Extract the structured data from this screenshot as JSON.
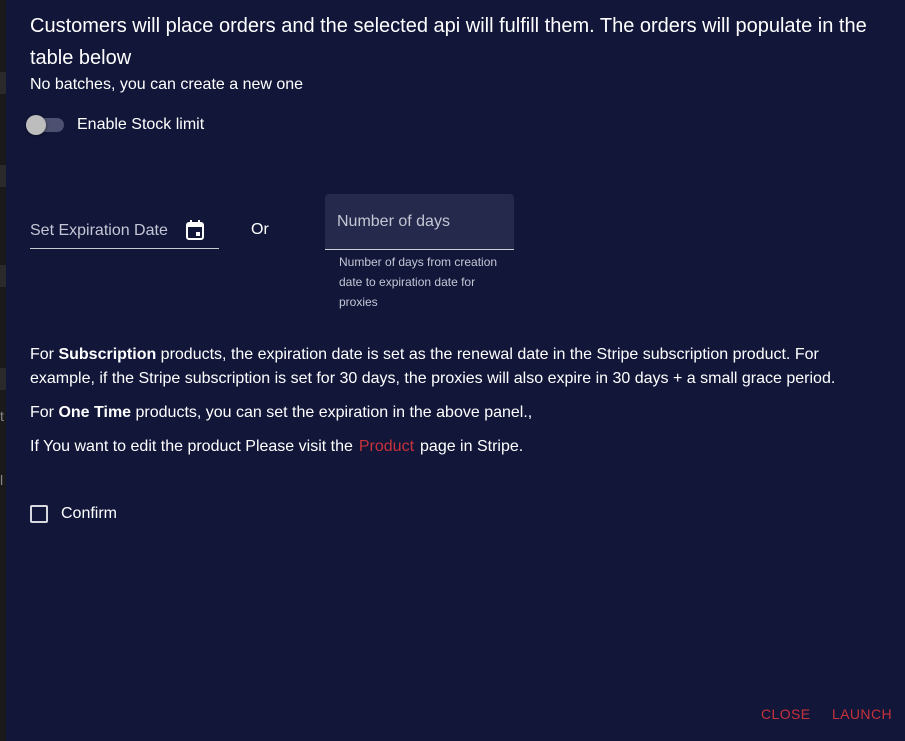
{
  "dialog": {
    "intro": "Customers will place orders and the selected api will fulfill them. The orders will populate in the table below",
    "no_batches": "No batches, you can create a new one",
    "stock_toggle": {
      "label": "Enable Stock limit",
      "checked": false
    },
    "expiration": {
      "date_label": "Set Expiration Date",
      "date_icon": "calendar-icon",
      "or_text": "Or",
      "days_placeholder": "Number of days",
      "days_helper": "Number of days from creation date to expiration date for proxies"
    },
    "info": {
      "p1_prefix": "For ",
      "p1_bold": "Subscription",
      "p1_rest": " products, the expiration date is set as the renewal date in the Stripe subscription product. For example, if the Stripe subscription is set for 30 days, the proxies will also expire in 30 days + a small grace period.",
      "p2_prefix": "For ",
      "p2_bold": "One Time",
      "p2_rest": " products, you can set the expiration in the above panel.,",
      "p3_prefix": "If You want to edit the product Please visit the",
      "p3_link": "Product",
      "p3_suffix": "page in Stripe."
    },
    "confirm": {
      "label": "Confirm",
      "checked": false
    },
    "actions": {
      "close": "CLOSE",
      "launch": "LAUNCH"
    }
  },
  "background": {
    "frag1": "t",
    "frag2": "l"
  },
  "colors": {
    "dialog_bg": "#12173a",
    "accent": "#c7313a",
    "field_bg": "#252a4c"
  }
}
